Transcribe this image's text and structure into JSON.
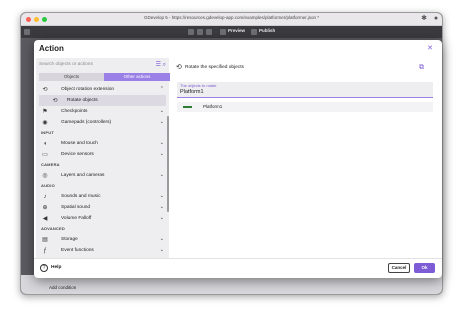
{
  "browser": {
    "title": "GDevelop 5 - https://resources.gdevelop-app.com/examples/platformer/platformer.json *"
  },
  "app_toolbar": {
    "preview_label": "Preview",
    "publish_label": "Publish"
  },
  "background": {
    "add_condition": "Add condition"
  },
  "dialog": {
    "title": "Action",
    "search": {
      "placeholder": "Search objects or actions"
    },
    "tabs": [
      {
        "label": "Objects",
        "active": false
      },
      {
        "label": "Other actions",
        "active": true
      }
    ],
    "list": [
      {
        "label": "Object rotation extension",
        "icon": "rotate-icon",
        "expanded": true
      },
      {
        "label": "Rotate objects",
        "icon": "rotate-icon",
        "sub": true,
        "selected": true
      },
      {
        "label": "Checkpoints",
        "icon": "checkpoint-icon"
      },
      {
        "label": "Gamepads (controllers)",
        "icon": "gamepad-icon"
      },
      {
        "section": "INPUT"
      },
      {
        "label": "Mouse and touch",
        "icon": "mouse-icon"
      },
      {
        "label": "Device sensors",
        "icon": "sensor-icon"
      },
      {
        "section": "CAMERA"
      },
      {
        "label": "Layers and cameras",
        "icon": "camera-icon"
      },
      {
        "section": "AUDIO"
      },
      {
        "label": "Sounds and music",
        "icon": "music-icon"
      },
      {
        "label": "Spatial sound",
        "icon": "spatial-sound-icon"
      },
      {
        "label": "Volume Falloff",
        "icon": "volume-icon"
      },
      {
        "section": "ADVANCED"
      },
      {
        "label": "Storage",
        "icon": "storage-icon"
      },
      {
        "label": "Event functions",
        "icon": "function-icon"
      }
    ],
    "right": {
      "action_title": "Rotate the specified objects",
      "param_label": "The objects to rotate",
      "param_value": "Platform1",
      "object_item": "Platform1"
    },
    "footer": {
      "help_label": "Help",
      "cancel_label": "Cancel",
      "ok_label": "Ok"
    }
  },
  "colors": {
    "accent": "#7d5cd6",
    "tab_active": "#9a7fe6",
    "panel_bg": "#eeedf0"
  }
}
